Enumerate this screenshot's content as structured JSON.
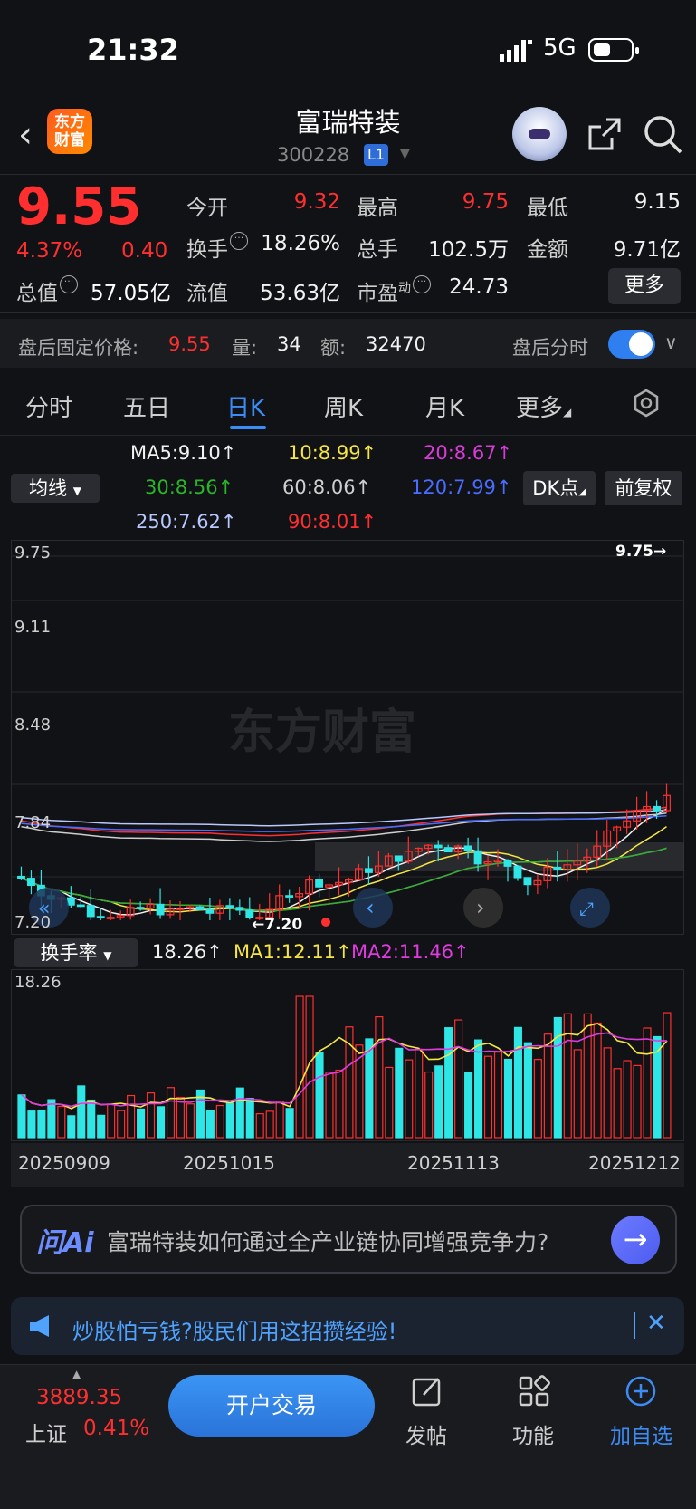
{
  "status_bar": {
    "time": "21:32",
    "network": "5G"
  },
  "header": {
    "logo_text": "东方财富",
    "stock_name": "富瑞特装",
    "stock_code": "300228",
    "level_badge": "L1"
  },
  "quote": {
    "price": "9.55",
    "change_pct": "4.37%",
    "change": "0.40",
    "total_value_label": "总值",
    "total_value": "57.05亿",
    "open_label": "今开",
    "open": "9.32",
    "high_label": "最高",
    "high": "9.75",
    "low_label": "最低",
    "low": "9.15",
    "turnover_label": "换手",
    "turnover": "18.26%",
    "volume_label": "总手",
    "volume": "102.5万",
    "amount_label": "金额",
    "amount": "9.71亿",
    "float_label": "流值",
    "float_value": "53.63亿",
    "pe_label": "市盈",
    "pe_sup": "动",
    "pe": "24.73",
    "more_button": "更多"
  },
  "after_hours": {
    "price_label": "盘后固定价格:",
    "price": "9.55",
    "qty_label": "量:",
    "qty": "34",
    "amount_label": "额:",
    "amount": "32470",
    "timeshare_label": "盘后分时",
    "toggle_on": true
  },
  "tabs": [
    "分时",
    "五日",
    "日K",
    "周K",
    "月K",
    "更多"
  ],
  "active_tab": "日K",
  "ma_panel": {
    "selector": "均线",
    "dk_button": "DK点",
    "fq_button": "前复权",
    "items": [
      {
        "text": "MA5:9.10↑",
        "color": "#f2f2f2"
      },
      {
        "text": "10:8.99↑",
        "color": "#f5e642"
      },
      {
        "text": "20:8.67↑",
        "color": "#d93bd9"
      },
      {
        "text": "30:8.56↑",
        "color": "#2bb52b"
      },
      {
        "text": "60:8.06↑",
        "color": "#cfcfcf"
      },
      {
        "text": "120:7.99↑",
        "color": "#4a6cff"
      },
      {
        "text": "250:7.62↑",
        "color": "#b9c8ff"
      },
      {
        "text": "90:8.01↑",
        "color": "#ff2f2f"
      }
    ]
  },
  "chart_data": [
    {
      "type": "candlestick",
      "y_ticks": [
        "9.75",
        "9.11",
        "8.48",
        "7.84",
        "7.20"
      ],
      "ylim": [
        7.2,
        9.75
      ],
      "high_marker": "9.75→",
      "low_marker": "←7.20",
      "up_color": "#ff2f2f",
      "down_color": "#2ee6e6",
      "watermark": "东方财富"
    },
    {
      "type": "bar",
      "indicator_selector": "换手率",
      "turnover_value": "18.26↑",
      "ma1_label": "MA1:12.11↑",
      "ma2_label": "MA2:11.46↑",
      "y_top_label": "18.26",
      "x_ticks": [
        "20250909",
        "20251015",
        "20251113",
        "20251212"
      ]
    }
  ],
  "ai": {
    "logo": "问Ai",
    "question": "富瑞特装如何通过全产业链协同增强竞争力?"
  },
  "notice": {
    "text": "炒股怕亏钱?股民们用这招攒经验!"
  },
  "bottom": {
    "index_value": "3889.35",
    "index_name": "上证",
    "index_pct": "0.41%",
    "open_account": "开户交易",
    "nav": [
      {
        "label": "发帖",
        "icon": "edit-icon"
      },
      {
        "label": "功能",
        "icon": "grid-icon"
      },
      {
        "label": "加自选",
        "icon": "plus-circle-icon"
      }
    ]
  }
}
